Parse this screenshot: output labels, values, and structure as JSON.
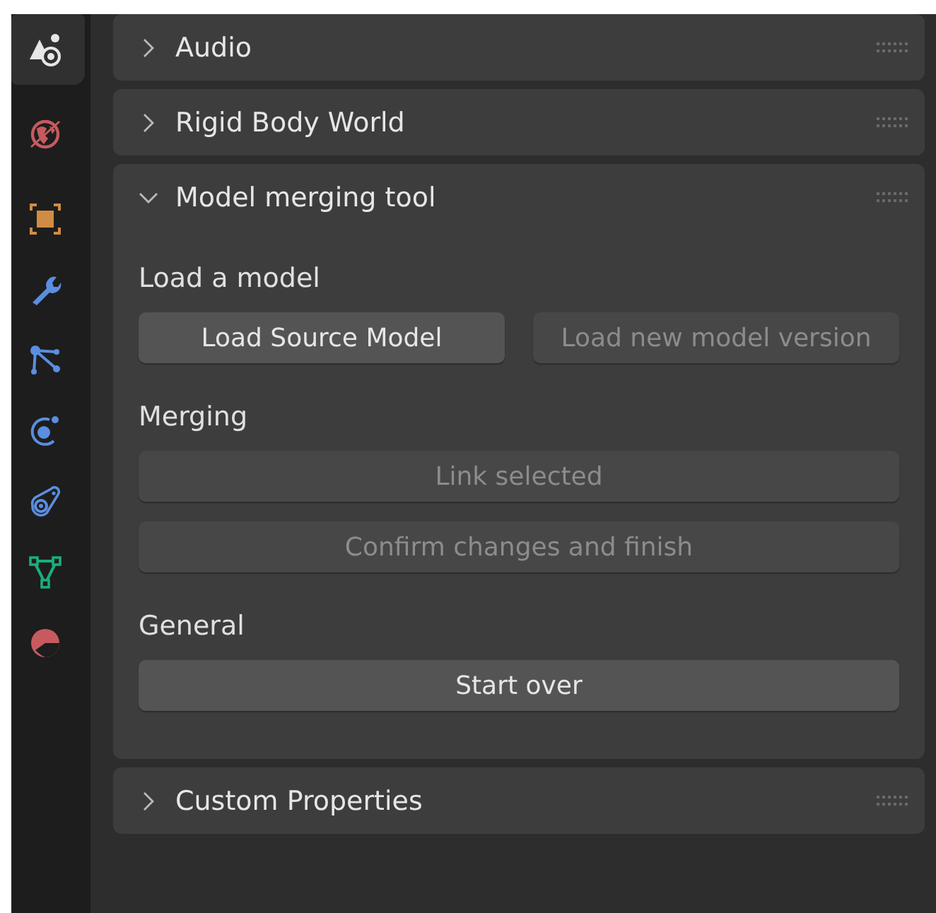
{
  "sidebar": {
    "tabs": [
      {
        "selected": true
      },
      {
        "selected": false
      },
      {
        "selected": false
      },
      {
        "selected": false
      },
      {
        "selected": false
      },
      {
        "selected": false
      },
      {
        "selected": false
      },
      {
        "selected": false
      },
      {
        "selected": false
      }
    ]
  },
  "panels": [
    {
      "title": "Audio",
      "expanded": false
    },
    {
      "title": "Rigid Body World",
      "expanded": false
    },
    {
      "title": "Model merging tool",
      "expanded": true,
      "sections": [
        {
          "label": "Load a model",
          "buttons": [
            {
              "label": "Load Source Model",
              "disabled": false
            },
            {
              "label": "Load new model version",
              "disabled": true
            }
          ]
        },
        {
          "label": "Merging",
          "buttons": [
            {
              "label": "Link selected",
              "disabled": true
            }
          ],
          "buttons_2": [
            {
              "label": "Confirm changes and finish",
              "disabled": true
            }
          ]
        },
        {
          "label": "General",
          "buttons": [
            {
              "label": "Start over",
              "disabled": false
            }
          ]
        }
      ]
    },
    {
      "title": "Custom Properties",
      "expanded": false
    }
  ]
}
